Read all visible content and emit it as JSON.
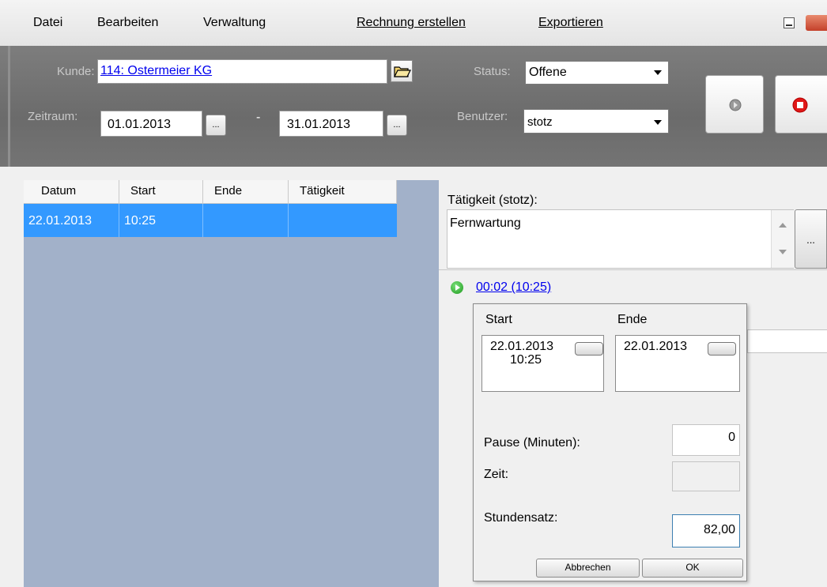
{
  "menu": {
    "datei": "Datei",
    "bearbeiten": "Bearbeiten",
    "verwaltung": "Verwaltung",
    "rechnung": "Rechnung erstellen",
    "exportieren": "Exportieren"
  },
  "filters": {
    "kunde_label": "Kunde:",
    "kunde_value": "114: Ostermeier KG",
    "zeitraum_label": "Zeitraum:",
    "date_from": "01.01.2013",
    "date_sep": "-",
    "date_to": "31.01.2013",
    "browse": "...",
    "status_label": "Status:",
    "status_value": "Offene",
    "benutzer_label": "Benutzer:",
    "benutzer_value": "stotz"
  },
  "grid": {
    "columns": [
      "Datum",
      "Start",
      "Ende",
      "Tätigkeit"
    ],
    "rows": [
      {
        "datum": "22.01.2013",
        "start": "10:25",
        "ende": "",
        "taetigkeit": ""
      }
    ]
  },
  "activity": {
    "label": "Tätigkeit (stotz):",
    "text": "Fernwartung",
    "more": "...",
    "timer_link": "00:02 (10:25)"
  },
  "popup": {
    "start_label": "Start",
    "ende_label": "Ende",
    "start_date": "22.01.2013",
    "start_time": "10:25",
    "end_date": "22.01.2013",
    "pause_label": "Pause (Minuten):",
    "pause_value": "0",
    "zeit_label": "Zeit:",
    "zeit_value": "",
    "stundensatz_label": "Stundensatz:",
    "stundensatz_value": "82,00",
    "cancel": "Abbrechen",
    "ok": "OK"
  }
}
